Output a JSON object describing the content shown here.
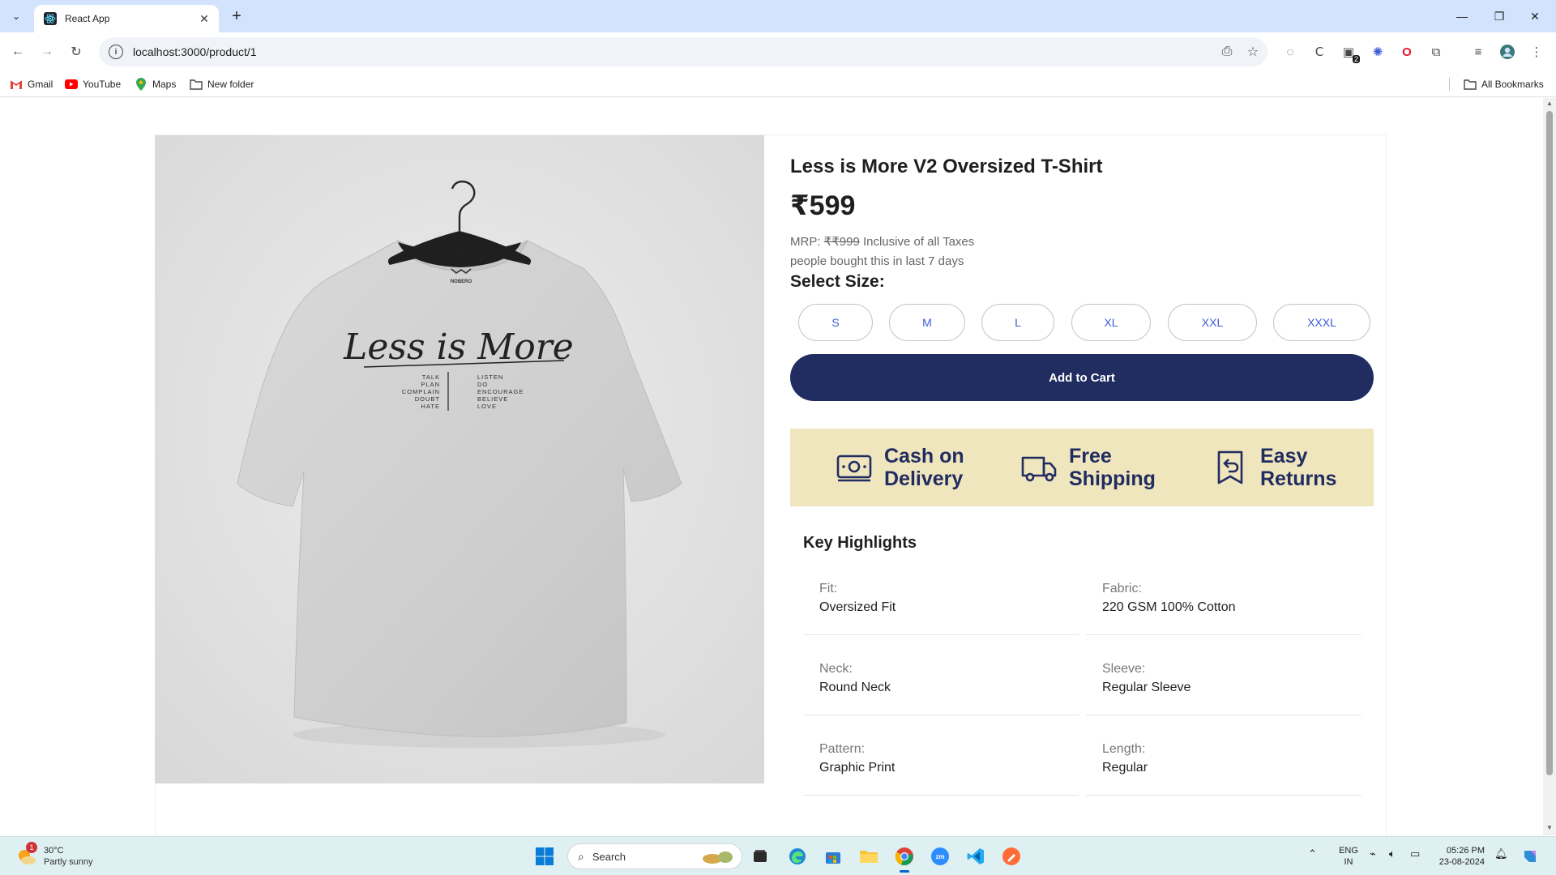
{
  "browser": {
    "tab_title": "React App",
    "url": "localhost:3000/product/1",
    "bookmarks": [
      {
        "label": "Gmail",
        "icon": "gmail-icon"
      },
      {
        "label": "YouTube",
        "icon": "youtube-icon"
      },
      {
        "label": "Maps",
        "icon": "maps-icon"
      },
      {
        "label": "New folder",
        "icon": "folder-icon"
      }
    ],
    "all_bookmarks_label": "All Bookmarks",
    "extension_badge": "2"
  },
  "product": {
    "title": "Less is More V2 Oversized T-Shirt",
    "price": "₹599",
    "mrp_label": "MRP: ",
    "mrp_value": "₹₹999",
    "tax_note": " Inclusive of all Taxes",
    "sold_note": "people bought this in last 7 days",
    "select_size_label": "Select Size:",
    "sizes": [
      "S",
      "M",
      "L",
      "XL",
      "XXL",
      "XXXL"
    ],
    "add_to_cart_label": "Add to Cart",
    "image": {
      "brand_mark": "NOBERO",
      "print_script": "Less is More",
      "print_left": [
        "TALK",
        "PLAN",
        "COMPLAIN",
        "DOUBT",
        "HATE"
      ],
      "print_right": [
        "LISTEN",
        "DO",
        "ENCOURAGE",
        "BELIEVE",
        "LOVE"
      ]
    }
  },
  "features": [
    {
      "icon": "cash-icon",
      "label": "Cash on\nDelivery"
    },
    {
      "icon": "truck-icon",
      "label": "Free\nShipping"
    },
    {
      "icon": "return-icon",
      "label": "Easy\nReturns"
    }
  ],
  "key_highlights": {
    "title": "Key Highlights",
    "items": [
      {
        "label": "Fit:",
        "value": "Oversized Fit"
      },
      {
        "label": "Fabric:",
        "value": "220 GSM 100% Cotton"
      },
      {
        "label": "Neck:",
        "value": "Round Neck"
      },
      {
        "label": "Sleeve:",
        "value": "Regular Sleeve"
      },
      {
        "label": "Pattern:",
        "value": "Graphic Print"
      },
      {
        "label": "Length:",
        "value": "Regular"
      }
    ]
  },
  "taskbar": {
    "weather_temp": "30°C",
    "weather_desc": "Partly sunny",
    "weather_badge": "1",
    "search_placeholder": "Search",
    "lang_top": "ENG",
    "lang_bottom": "IN",
    "time": "05:26 PM",
    "date": "23-08-2024"
  },
  "colors": {
    "accent_navy": "#212c61",
    "feature_bg": "#f0e6bd",
    "size_text": "#3b5bd6"
  }
}
